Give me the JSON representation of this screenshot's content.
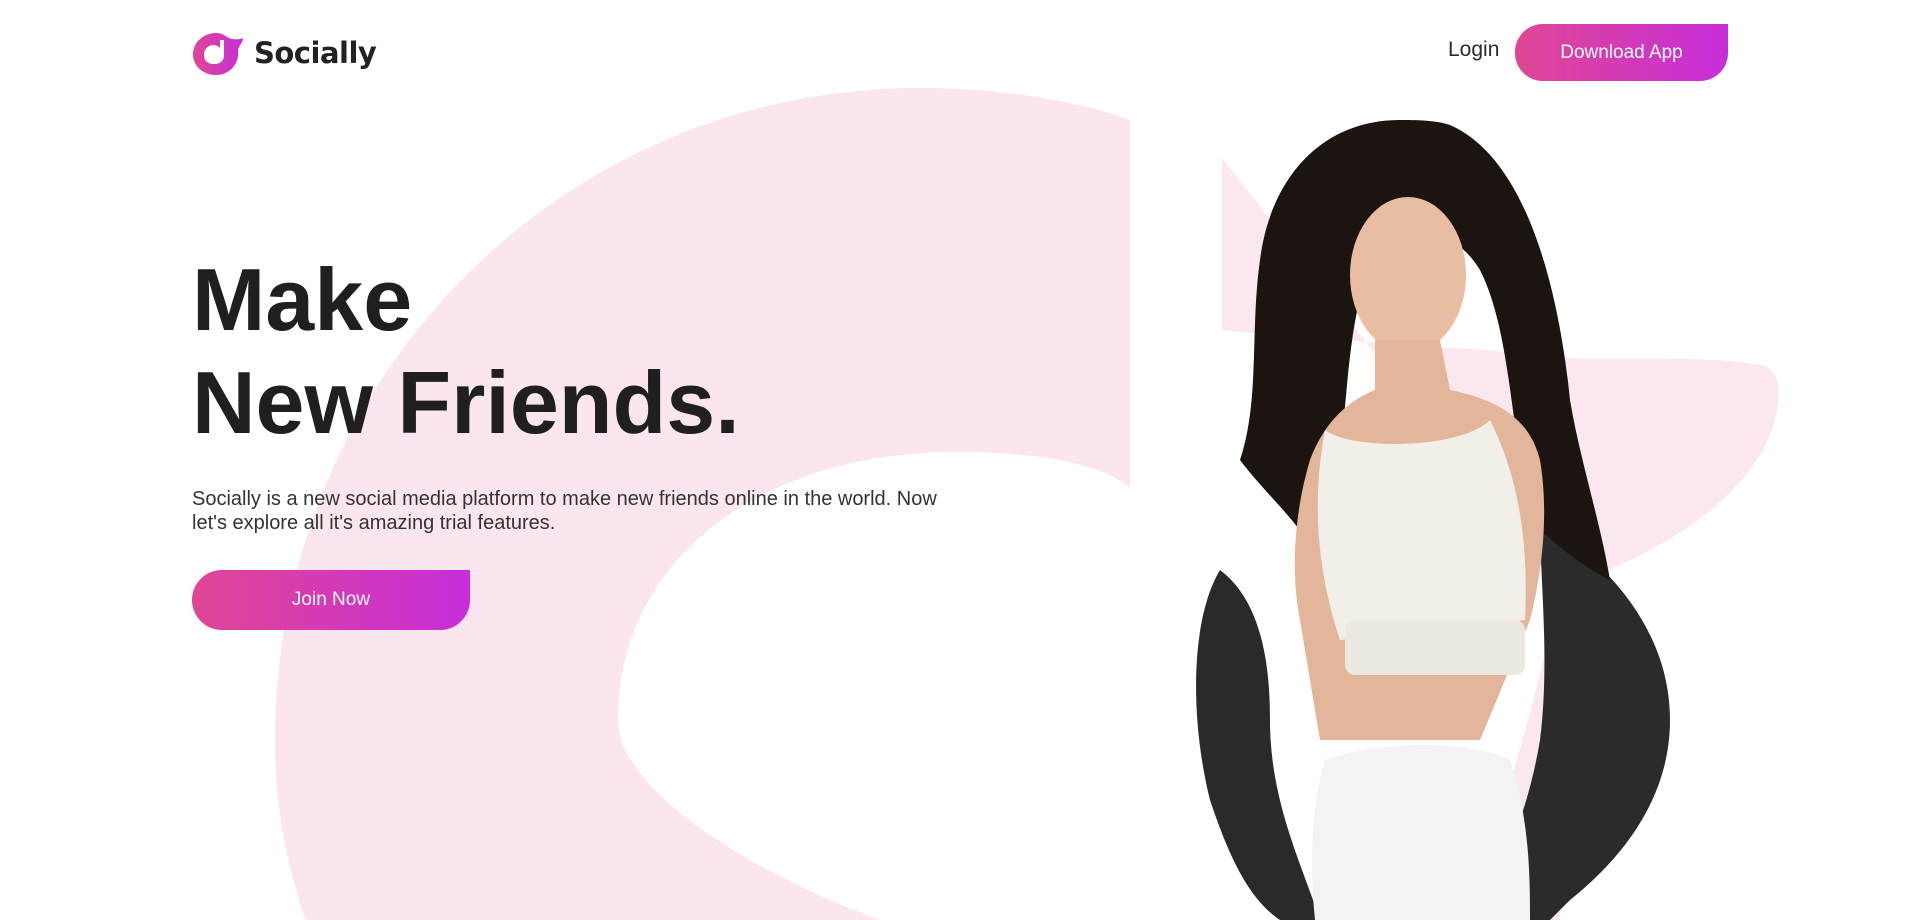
{
  "colors": {
    "brand_gradient_start": "#e04694",
    "brand_gradient_end": "#c72ed9",
    "background_shape": "#fbe6ef",
    "heading_text": "#1f1f1f",
    "body_text": "#333333"
  },
  "header": {
    "logo_icon": "socially-logo-icon",
    "logo_text": "Socially",
    "login_label": "Login",
    "download_label": "Download App"
  },
  "hero": {
    "title_line1": "Make",
    "title_line2": "New Friends.",
    "description": "Socially is a new social media platform to make new friends online in the world. Now let's explore all it's amazing trial features.",
    "join_label": "Join Now",
    "photo_icon": "person-photo"
  }
}
